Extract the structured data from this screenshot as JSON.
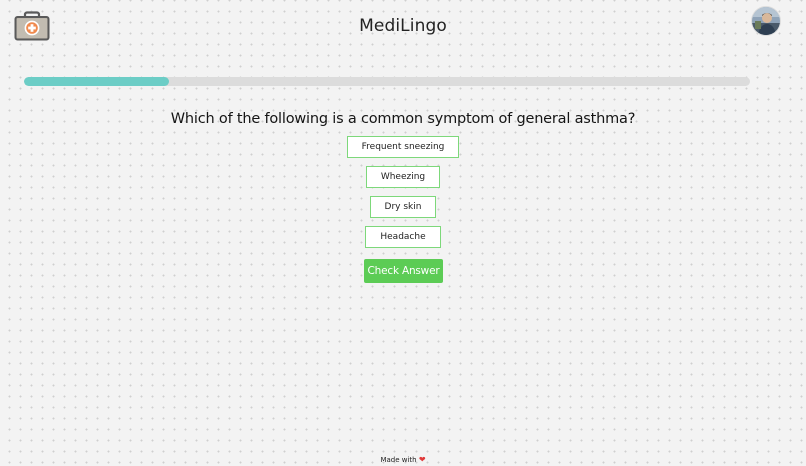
{
  "header": {
    "title": "MediLingo",
    "logo_icon": "medical-kit-icon",
    "avatar_icon": "user-avatar"
  },
  "progress": {
    "fraction": 0.2,
    "fill_color": "#6ccdc6",
    "track_color": "#dcdcdc"
  },
  "quiz": {
    "question": "Which of the following is a common symptom of general asthma?",
    "options": [
      "Frequent sneezing",
      "Wheezing",
      "Dry skin",
      "Headache"
    ],
    "check_label": "Check Answer",
    "accent_color": "#5ccc55"
  },
  "footer": {
    "text": "Made with",
    "heart_icon": "heart-icon"
  }
}
